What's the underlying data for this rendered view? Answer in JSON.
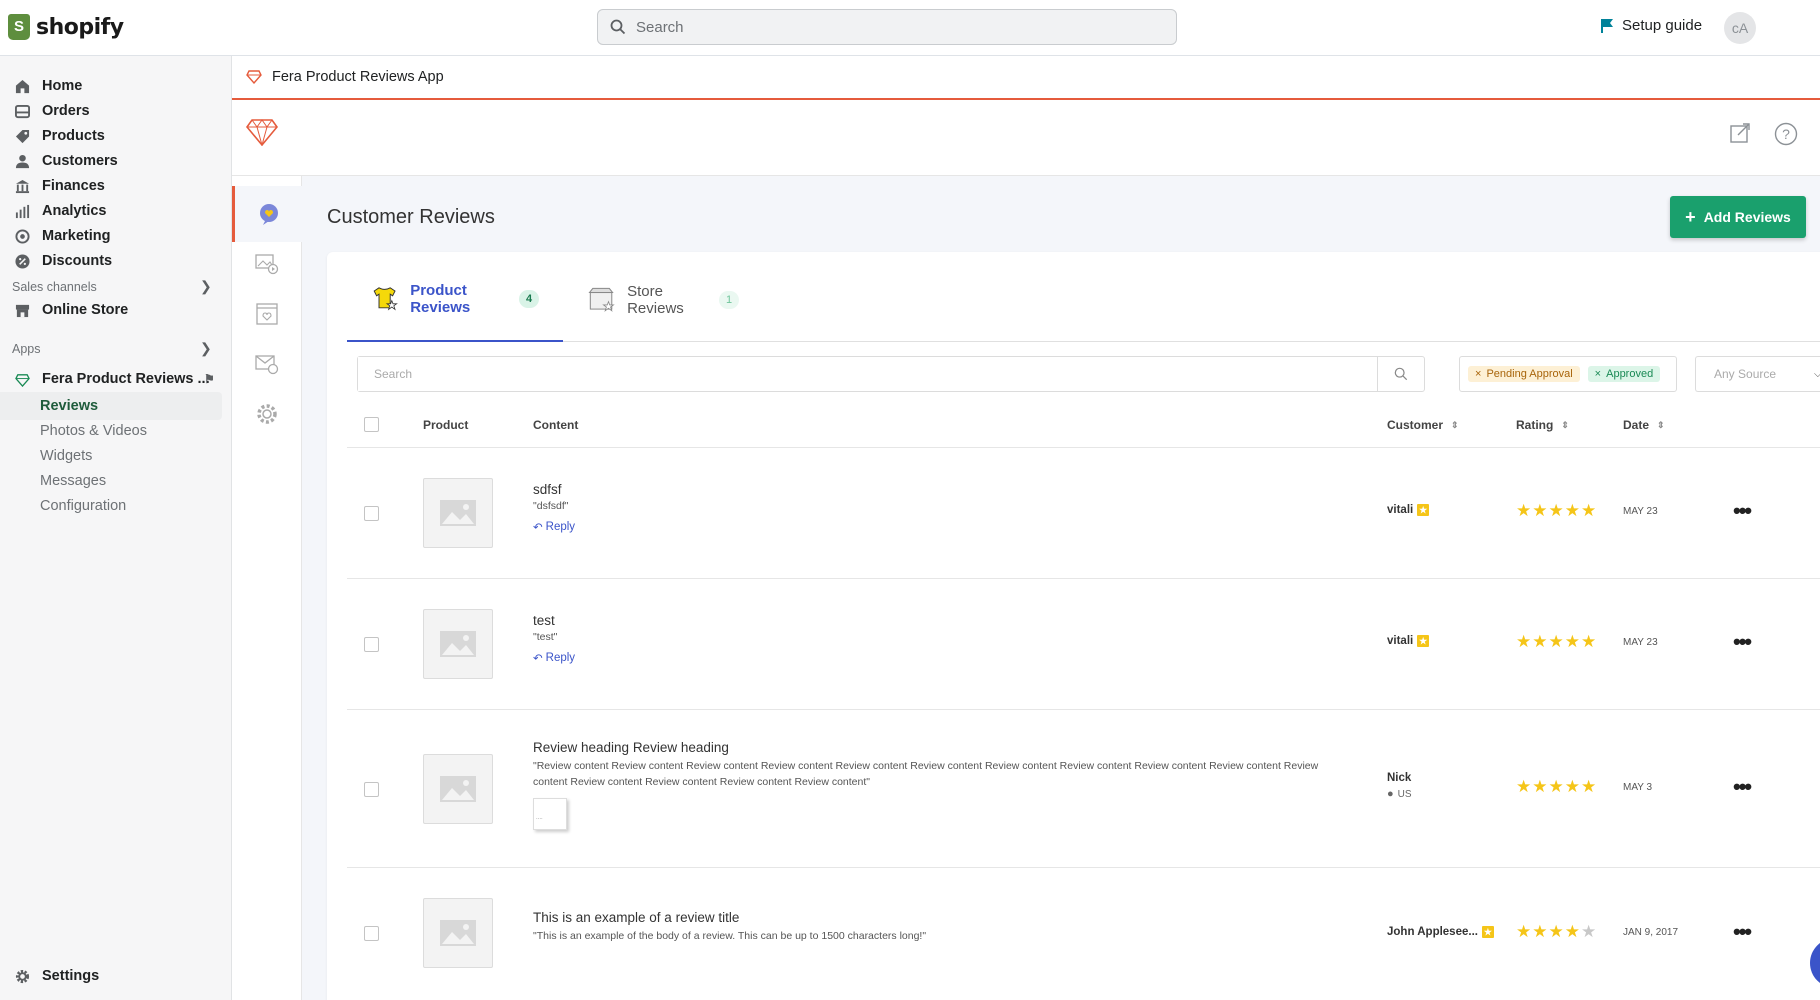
{
  "topbar": {
    "brand": "shopify",
    "search_placeholder": "Search",
    "setup_guide": "Setup guide",
    "avatar_initials": "cA"
  },
  "sidebar": {
    "items": [
      {
        "label": "Home",
        "icon": "home-icon"
      },
      {
        "label": "Orders",
        "icon": "orders-icon"
      },
      {
        "label": "Products",
        "icon": "tag-icon"
      },
      {
        "label": "Customers",
        "icon": "person-icon"
      },
      {
        "label": "Finances",
        "icon": "bank-icon"
      },
      {
        "label": "Analytics",
        "icon": "bar-chart-icon"
      },
      {
        "label": "Marketing",
        "icon": "target-icon"
      },
      {
        "label": "Discounts",
        "icon": "discount-icon"
      }
    ],
    "sales_channels_label": "Sales channels",
    "online_store": "Online Store",
    "apps_label": "Apps",
    "app_name": "Fera Product Reviews ...",
    "app_subitems": [
      "Reviews",
      "Photos & Videos",
      "Widgets",
      "Messages",
      "Configuration"
    ],
    "settings": "Settings"
  },
  "app": {
    "header_title": "Fera Product Reviews App",
    "page_title": "Customer Reviews",
    "add_button": "Add Reviews",
    "tabs": [
      {
        "label": "Product Reviews",
        "count": "4"
      },
      {
        "label": "Store Reviews",
        "count": "1"
      }
    ],
    "search_placeholder": "Search",
    "status_filters": [
      "Pending Approval",
      "Approved"
    ],
    "source_placeholder": "Any Source",
    "columns": {
      "product": "Product",
      "content": "Content",
      "customer": "Customer",
      "rating": "Rating",
      "date": "Date"
    },
    "reply_label": "Reply",
    "reviews": [
      {
        "title": "sdfsf",
        "body": "\"dsfsdf\"",
        "customer": "vitali",
        "rating": 5,
        "date": "MAY 23",
        "has_reply": true
      },
      {
        "title": "test",
        "body": "\"test\"",
        "customer": "vitali",
        "rating": 5,
        "date": "MAY 23",
        "has_reply": true
      },
      {
        "title": "Review heading Review heading",
        "body": "\"Review content Review content Review content Review content Review content Review content Review content Review content Review content Review content Review content Review content Review content Review content Review content\"",
        "customer": "Nick",
        "country": "US",
        "rating": 5,
        "date": "MAY 3",
        "attachment_text": "...."
      },
      {
        "title": "This is an example of a review title",
        "body": "\"This is an example of the body of a review. This can be up to 1500 characters long!\"",
        "customer": "John Applesee...",
        "rating": 4,
        "date": "JAN 9, 2017"
      }
    ]
  },
  "colors": {
    "accent_green": "#1aa06d",
    "tab_blue": "#3b54c9",
    "fera_red": "#e55b3c",
    "star_yellow": "#f5c518"
  }
}
